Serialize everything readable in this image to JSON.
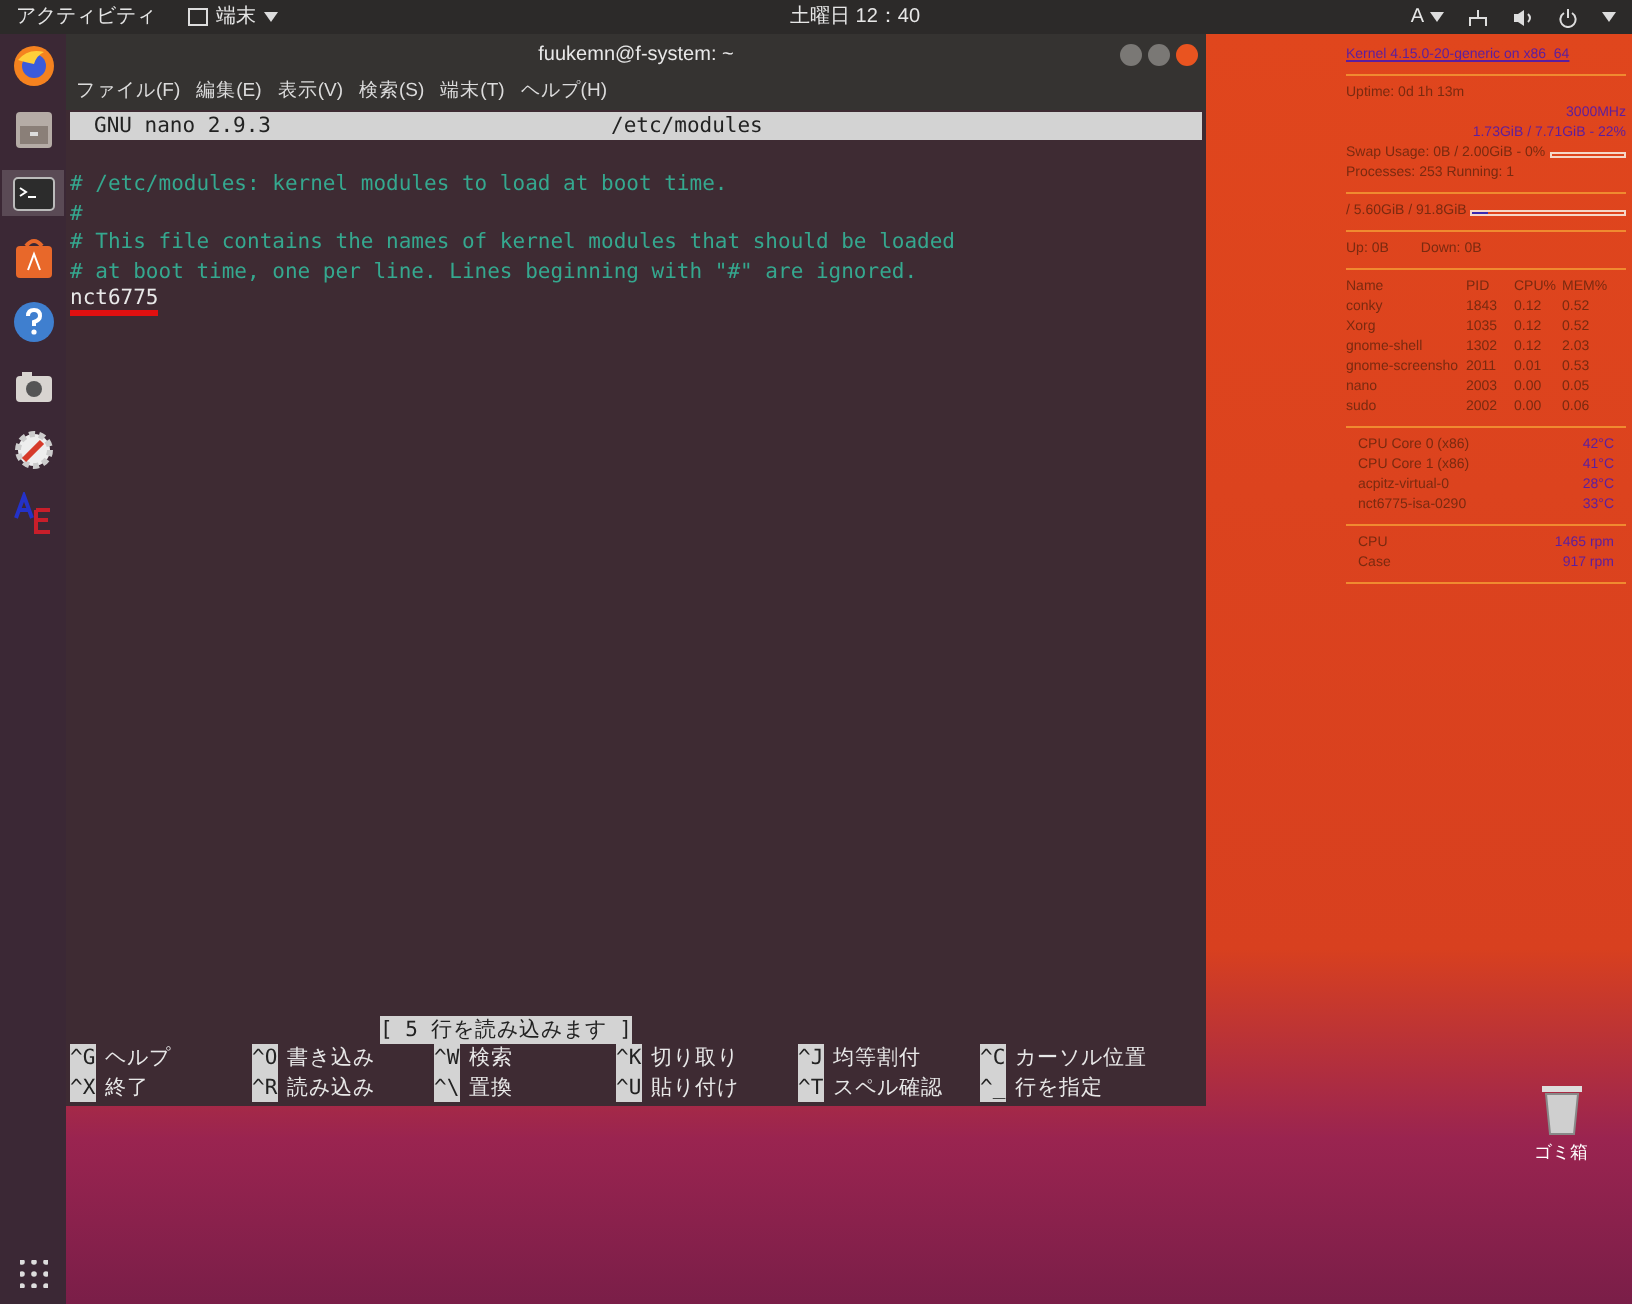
{
  "top_bar": {
    "activities": "アクティビティ",
    "app_menu": "端末",
    "clock": "土曜日 12：40",
    "input_method": "A"
  },
  "dock": {
    "items": [
      {
        "kind": "browser",
        "selected": false
      },
      {
        "kind": "files",
        "selected": false
      },
      {
        "kind": "terminal",
        "selected": true
      },
      {
        "kind": "software",
        "selected": false
      },
      {
        "kind": "help",
        "selected": false
      },
      {
        "kind": "screenshot",
        "selected": false
      },
      {
        "kind": "settings",
        "selected": false
      },
      {
        "kind": "fonts",
        "selected": false
      }
    ]
  },
  "window": {
    "title": "fuukemn@f-system: ~",
    "menu": [
      "ファイル(F)",
      "編集(E)",
      "表示(V)",
      "検索(S)",
      "端末(T)",
      "ヘルプ(H)"
    ]
  },
  "nano": {
    "version": "GNU nano 2.9.3",
    "filename": "/etc/modules",
    "lines": [
      {
        "text": "# /etc/modules: kernel modules to load at boot time.",
        "kind": "comment",
        "underlined": false
      },
      {
        "text": "#",
        "kind": "comment",
        "underlined": false
      },
      {
        "text": "# This file contains the names of kernel modules that should be loaded",
        "kind": "comment",
        "underlined": false
      },
      {
        "text": "# at boot time, one per line. Lines beginning with \"#\" are ignored.",
        "kind": "comment",
        "underlined": false
      },
      {
        "text": "nct6775",
        "kind": "text",
        "underlined": true
      }
    ],
    "status": "[ 5 行を読み込みます ]",
    "shortcuts": [
      [
        {
          "key": "^G",
          "label": "ヘルプ"
        },
        {
          "key": "^O",
          "label": "書き込み"
        },
        {
          "key": "^W",
          "label": "検索"
        },
        {
          "key": "^K",
          "label": "切り取り"
        },
        {
          "key": "^J",
          "label": "均等割付"
        },
        {
          "key": "^C",
          "label": "カーソル位置"
        }
      ],
      [
        {
          "key": "^X",
          "label": "終了"
        },
        {
          "key": "^R",
          "label": "読み込み"
        },
        {
          "key": "^\\",
          "label": "置換"
        },
        {
          "key": "^U",
          "label": "貼り付け"
        },
        {
          "key": "^T",
          "label": "スペル確認"
        },
        {
          "key": "^_",
          "label": "行を指定"
        }
      ]
    ]
  },
  "conky": {
    "sections": [
      {
        "rows": [
          {
            "kind": "title",
            "cells": [
              "Kernel 4.15.0-20-generic on x86_64"
            ]
          }
        ]
      },
      {
        "rows": [
          {
            "kind": "text",
            "cells": [
              "Uptime: 0d 1h 13m"
            ]
          },
          {
            "kind": "right",
            "cells": [
              "3000MHz"
            ]
          },
          {
            "kind": "right",
            "cells": [
              "1.73GiB / 7.71GiB - 22%"
            ]
          },
          {
            "kind": "bar",
            "cells": [
              "Swap Usage: 0B / 2.00GiB - 0%"
            ],
            "level": 0
          },
          {
            "kind": "text",
            "cells": [
              "Processes: 253 Running: 1"
            ]
          }
        ]
      },
      {
        "rows": [
          {
            "kind": "bar",
            "cells": [
              "/ 5.60GiB / 91.8GiB"
            ],
            "level": 0.1
          }
        ]
      },
      {
        "rows": [
          {
            "kind": "text",
            "cells": [
              "Up: 0B",
              "Down: 0B"
            ]
          }
        ]
      },
      {
        "rows": [
          {
            "kind": "table",
            "cells": [
              "Name",
              "PID",
              "CPU%",
              "MEM%"
            ]
          },
          {
            "kind": "table",
            "cells": [
              "conky",
              "1843",
              "0.12",
              "0.52"
            ]
          },
          {
            "kind": "table",
            "cells": [
              "Xorg",
              "1035",
              "0.12",
              "0.52"
            ]
          },
          {
            "kind": "table",
            "cells": [
              "gnome-shell",
              "1302",
              "0.12",
              "2.03"
            ]
          },
          {
            "kind": "table",
            "cells": [
              "gnome-screensho",
              "2011",
              "0.01",
              "0.53"
            ]
          },
          {
            "kind": "table",
            "cells": [
              "nano",
              "2003",
              "0.00",
              "0.05"
            ]
          },
          {
            "kind": "table",
            "cells": [
              "sudo",
              "2002",
              "0.00",
              "0.06"
            ]
          }
        ]
      },
      {
        "rows": [
          {
            "kind": "pair",
            "cells": [
              "CPU Core 0 (x86)",
              "42°C"
            ]
          },
          {
            "kind": "pair",
            "cells": [
              "CPU Core 1 (x86)",
              "41°C"
            ]
          },
          {
            "kind": "pair",
            "cells": [
              "acpitz-virtual-0",
              "28°C"
            ]
          },
          {
            "kind": "pair",
            "cells": [
              "nct6775-isa-0290",
              "33°C"
            ]
          }
        ]
      },
      {
        "rows": [
          {
            "kind": "pair",
            "cells": [
              "CPU",
              "1465 rpm"
            ]
          },
          {
            "kind": "pair",
            "cells": [
              "Case",
              "917 rpm"
            ]
          }
        ]
      }
    ]
  },
  "desktop": {
    "trash_label": "ゴミ箱"
  }
}
